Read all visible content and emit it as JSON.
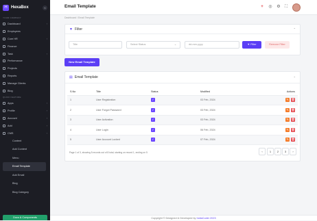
{
  "brand": {
    "name": "HexaBox"
  },
  "sidebar": {
    "sections": [
      "YOUR COMPANY",
      "QUICK FEATURE"
    ],
    "items": [
      {
        "label": "Dashboard",
        "chevron": true
      },
      {
        "label": "Employees",
        "chevron": false
      },
      {
        "label": "Core HR",
        "chevron": true
      },
      {
        "label": "Finance",
        "chevron": false
      },
      {
        "label": "Task",
        "chevron": true
      },
      {
        "label": "Performance",
        "chevron": false
      },
      {
        "label": "Projects",
        "chevron": false
      },
      {
        "label": "Reports",
        "chevron": false
      },
      {
        "label": "Manage Clients",
        "chevron": false
      },
      {
        "label": "Blog",
        "chevron": false
      }
    ],
    "items2": [
      {
        "label": "Apps",
        "chevron": true
      },
      {
        "label": "Profile",
        "chevron": true
      },
      {
        "label": "Account",
        "chevron": true
      },
      {
        "label": "Add",
        "chevron": true
      },
      {
        "label": "CMS",
        "chevron": true
      }
    ],
    "cms_sub": [
      "Content",
      "Add Content",
      "Menu",
      "Email Template",
      "Add Email",
      "Blog",
      "Blog Category"
    ],
    "active_sub": "Email Template",
    "bottom_button": "Docs & Components"
  },
  "header": {
    "title": "Email Template",
    "icons": [
      "plus-icon",
      "globe-icon",
      "gear-icon",
      "fullscreen-icon"
    ]
  },
  "breadcrumb": "Dashboard  /  Email Template",
  "filter": {
    "title": "Filter",
    "title_placeholder": "Title",
    "status_placeholder": "Select Status",
    "date_placeholder": "dd-mm-yyyy",
    "filter_button": "Filter",
    "remove_button": "Remove Filter"
  },
  "new_button": "New Email Template",
  "table": {
    "title": "Email Template",
    "columns": [
      "S.No",
      "Title",
      "Status",
      "Modified",
      "Actions"
    ],
    "rows": [
      {
        "sno": "1",
        "title": "User Registration",
        "modified": "03 Feb, 2024"
      },
      {
        "sno": "2",
        "title": "User Forgot Password",
        "modified": "03 Feb, 2024"
      },
      {
        "sno": "3",
        "title": "User Activation",
        "modified": "03 Feb, 2024"
      },
      {
        "sno": "4",
        "title": "User Login",
        "modified": "06 Feb, 2024"
      },
      {
        "sno": "5",
        "title": "User Account Locked",
        "modified": "07 Feb, 2024"
      }
    ]
  },
  "pagination": {
    "info": "Page 1 of 3, showing 5 records out of 8 total, starting on record 1, ending on 5",
    "pages": [
      "1",
      "2",
      "3"
    ],
    "prev": "‹",
    "next": "›"
  },
  "footer": {
    "text": "Copyright © Designed & Developed by",
    "highlight": "IndiaCoder 2023"
  }
}
